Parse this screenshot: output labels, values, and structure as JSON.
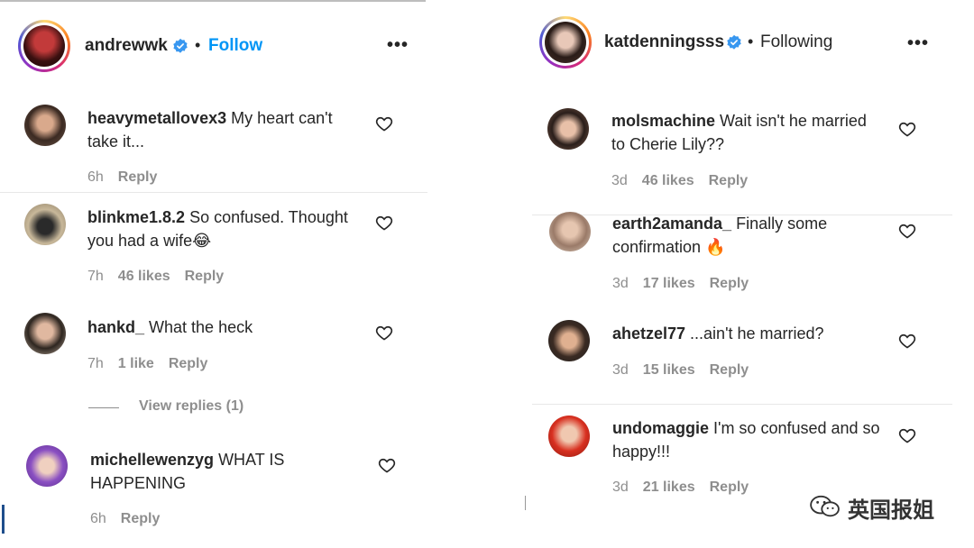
{
  "left_post": {
    "username": "andrewwk",
    "dot": "•",
    "follow_label": "Follow",
    "more": "•••",
    "comments": [
      {
        "user": "heavymetallovex3",
        "text": "My heart can't take it...",
        "time": "6h",
        "likes": "",
        "reply": "Reply"
      },
      {
        "user": "blinkme1.8.2",
        "text": "So confused. Thought you had a wife😂",
        "time": "7h",
        "likes": "46 likes",
        "reply": "Reply"
      },
      {
        "user": "hankd_",
        "text": "What the heck",
        "time": "7h",
        "likes": "1 like",
        "reply": "Reply"
      },
      {
        "user": "michellewenzyg",
        "text": "WHAT IS HAPPENING",
        "time": "6h",
        "likes": "",
        "reply": "Reply"
      }
    ],
    "view_replies": "View replies (1)"
  },
  "right_post": {
    "username": "katdenningsss",
    "dot": "•",
    "following_label": "Following",
    "more": "•••",
    "comments": [
      {
        "user": "molsmachine",
        "text": "Wait isn't he married to Cherie Lily??",
        "time": "3d",
        "likes": "46 likes",
        "reply": "Reply"
      },
      {
        "user": "earth2amanda_",
        "text": "Finally some confirmation 🔥",
        "time": "3d",
        "likes": "17 likes",
        "reply": "Reply"
      },
      {
        "user": "ahetzel77",
        "text": "...ain't he married?",
        "time": "3d",
        "likes": "15 likes",
        "reply": "Reply"
      },
      {
        "user": "undomaggie",
        "text": "I'm so confused and so happy!!!",
        "time": "3d",
        "likes": "21 likes",
        "reply": "Reply"
      }
    ]
  },
  "watermark": "英国报姐",
  "colors": {
    "link": "#0095f6",
    "verified": "#3897f0",
    "muted": "#8e8e8e",
    "text": "#262626"
  }
}
